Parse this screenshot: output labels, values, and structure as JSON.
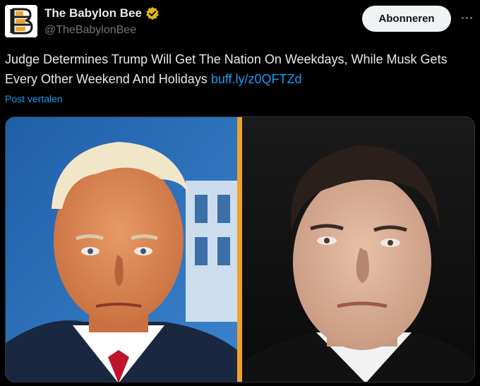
{
  "author": {
    "display_name": "The Babylon Bee",
    "handle": "@TheBabylonBee",
    "verified": true,
    "avatar_icon": "babylon-bee-logo-icon",
    "badge_color": "#e2b719"
  },
  "actions": {
    "follow_label": "Abonneren",
    "more_icon": "more-horizontal-icon"
  },
  "post": {
    "text": "Judge Determines Trump Will Get The Nation On Weekdays, While Musk Gets Every Other Weekend And Holidays ",
    "link_text": "buff.ly/z0QFTZd",
    "translate_label": "Post vertalen",
    "link_color": "#1d9bf0"
  },
  "media": {
    "type": "side-by-side photo collage",
    "divider_color": "#f0a22e"
  }
}
